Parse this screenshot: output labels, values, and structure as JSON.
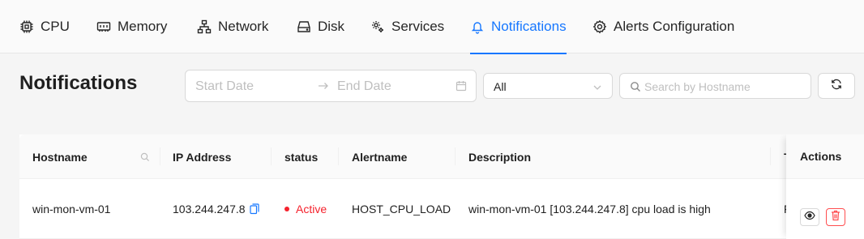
{
  "tabs": [
    {
      "label": "CPU",
      "icon": "cpu-icon"
    },
    {
      "label": "Memory",
      "icon": "memory-icon"
    },
    {
      "label": "Network",
      "icon": "network-icon"
    },
    {
      "label": "Disk",
      "icon": "disk-icon"
    },
    {
      "label": "Services",
      "icon": "services-icon"
    },
    {
      "label": "Notifications",
      "icon": "bell-icon",
      "active": true
    },
    {
      "label": "Alerts Configuration",
      "icon": "gear-icon"
    }
  ],
  "page": {
    "title": "Notifications"
  },
  "filters": {
    "start_placeholder": "Start Date",
    "end_placeholder": "End Date",
    "status_selected": "All",
    "search_placeholder": "Search by Hostname"
  },
  "table": {
    "columns": [
      "Hostname",
      "IP Address",
      "status",
      "Alertname",
      "Description",
      "T",
      "Actions"
    ],
    "rows": [
      {
        "hostname": "win-mon-vm-01",
        "ip": "103.244.247.8",
        "status": "Active",
        "alertname": "HOST_CPU_LOAD",
        "description": "win-mon-vm-01 [103.244.247.8] cpu load is high",
        "truncated": "F"
      }
    ]
  },
  "colors": {
    "accent": "#1677ff",
    "danger": "#f5222d"
  }
}
